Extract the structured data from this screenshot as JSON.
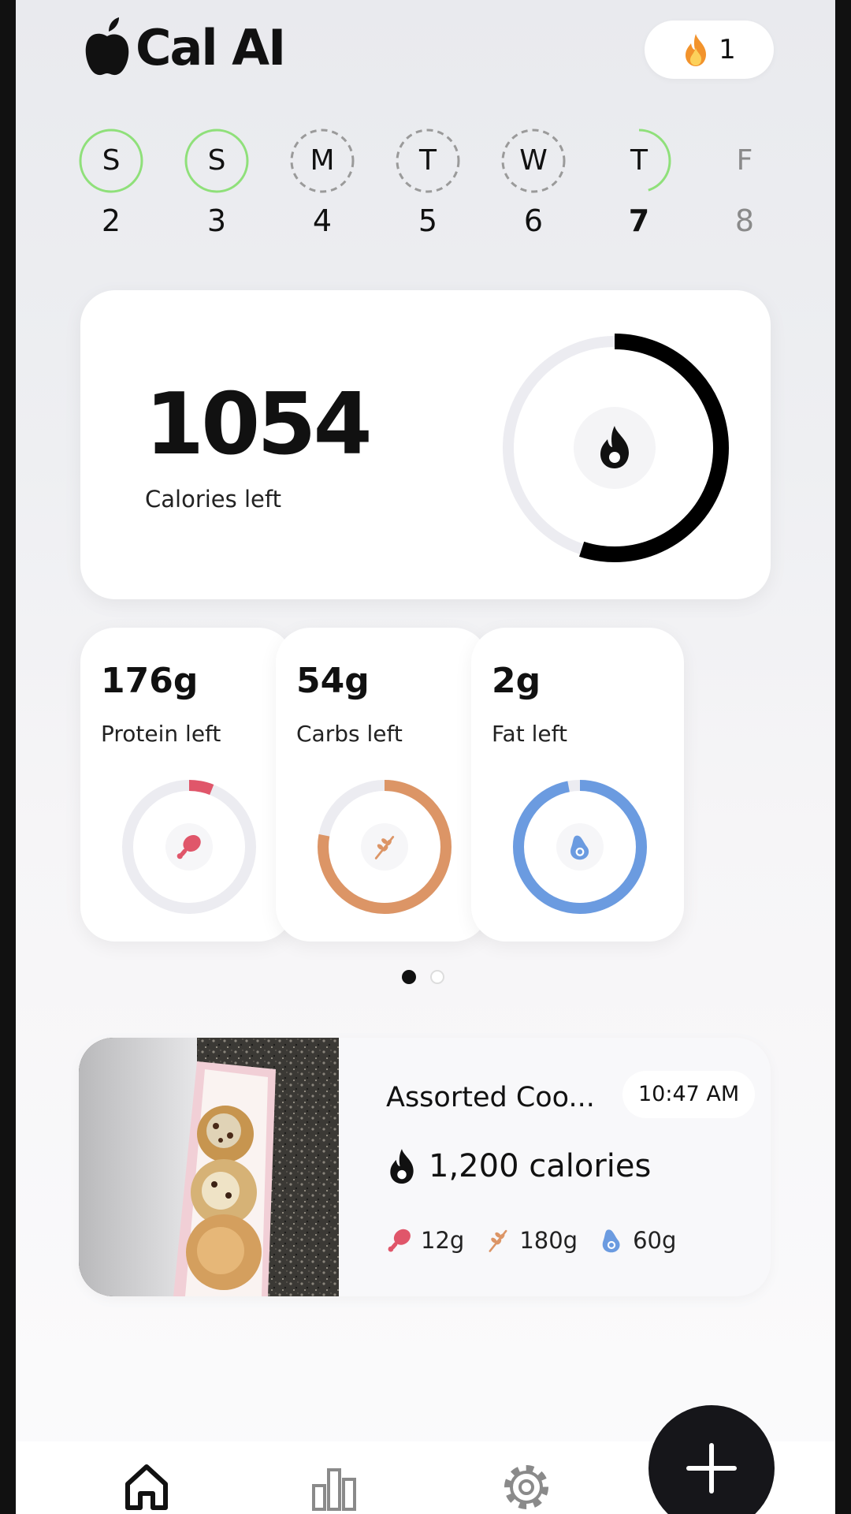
{
  "app": {
    "name": "Cal AI"
  },
  "streak": {
    "count": "1",
    "icon": "fire-icon"
  },
  "week": [
    {
      "letter": "S",
      "date": "2",
      "state": "complete"
    },
    {
      "letter": "S",
      "date": "3",
      "state": "complete"
    },
    {
      "letter": "M",
      "date": "4",
      "state": "missed"
    },
    {
      "letter": "T",
      "date": "5",
      "state": "missed"
    },
    {
      "letter": "W",
      "date": "6",
      "state": "missed"
    },
    {
      "letter": "T",
      "date": "7",
      "state": "today"
    },
    {
      "letter": "F",
      "date": "8",
      "state": "future"
    }
  ],
  "calories": {
    "value": "1054",
    "label": "Calories left",
    "progress": 0.55
  },
  "macros": [
    {
      "value": "176g",
      "label": "Protein left",
      "progress": 0.06,
      "color": "#e0566a",
      "icon": "drumstick-icon"
    },
    {
      "value": "54g",
      "label": "Carbs left",
      "progress": 0.78,
      "color": "#dc9566",
      "icon": "wheat-icon"
    },
    {
      "value": "2g",
      "label": "Fat left",
      "progress": 0.97,
      "color": "#6b9be0",
      "icon": "avocado-icon"
    }
  ],
  "pager": {
    "pages": 2,
    "active": 0
  },
  "food_log": [
    {
      "name": "Assorted Coo...",
      "time": "10:47 AM",
      "calories": "1,200 calories",
      "protein": "12g",
      "carbs": "180g",
      "fat": "60g"
    }
  ],
  "nav": {
    "items": [
      "home-icon",
      "chart-icon",
      "settings-icon"
    ],
    "active": "home-icon",
    "fab_icon": "plus-icon"
  },
  "colors": {
    "complete": "#8fe07a",
    "missed": "#9a9a9a",
    "track": "#ececf1",
    "calorie_ring": "#000000"
  }
}
